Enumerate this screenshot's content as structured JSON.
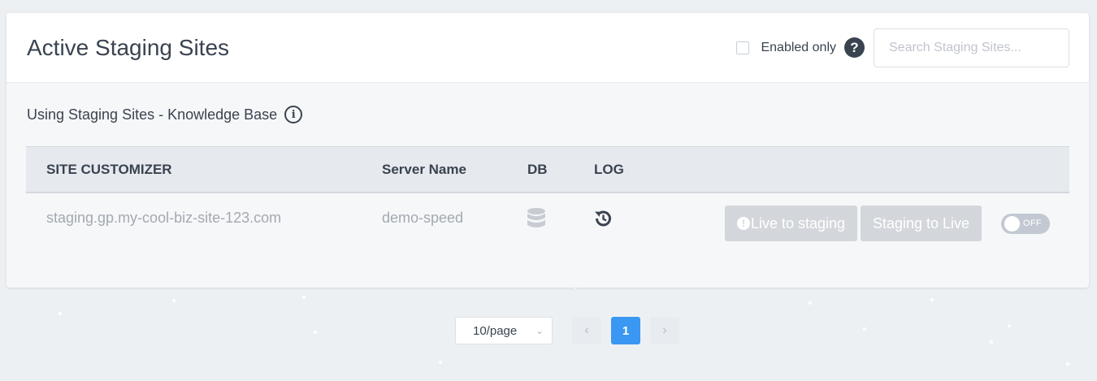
{
  "header": {
    "title": "Active Staging Sites",
    "enabled_only_label": "Enabled only",
    "search_placeholder": "Search Staging Sites..."
  },
  "kb_link": "Using Staging Sites - Knowledge Base",
  "table": {
    "columns": [
      "SITE CUSTOMIZER",
      "Server Name",
      "DB",
      "LOG"
    ],
    "rows": [
      {
        "site": "staging.gp.my-cool-biz-site-123.com",
        "server": "demo-speed",
        "live_to_staging_label": "Live to staging",
        "staging_to_live_label": "Staging to Live",
        "toggle_label": "OFF"
      }
    ]
  },
  "pagination": {
    "page_size": "10/page",
    "current_page": "1",
    "prev": "‹",
    "next": "›"
  },
  "colors": {
    "accent": "#3a97f2",
    "disabled_button": "#d3d6db",
    "toggle_off": "#c2c9d3"
  }
}
